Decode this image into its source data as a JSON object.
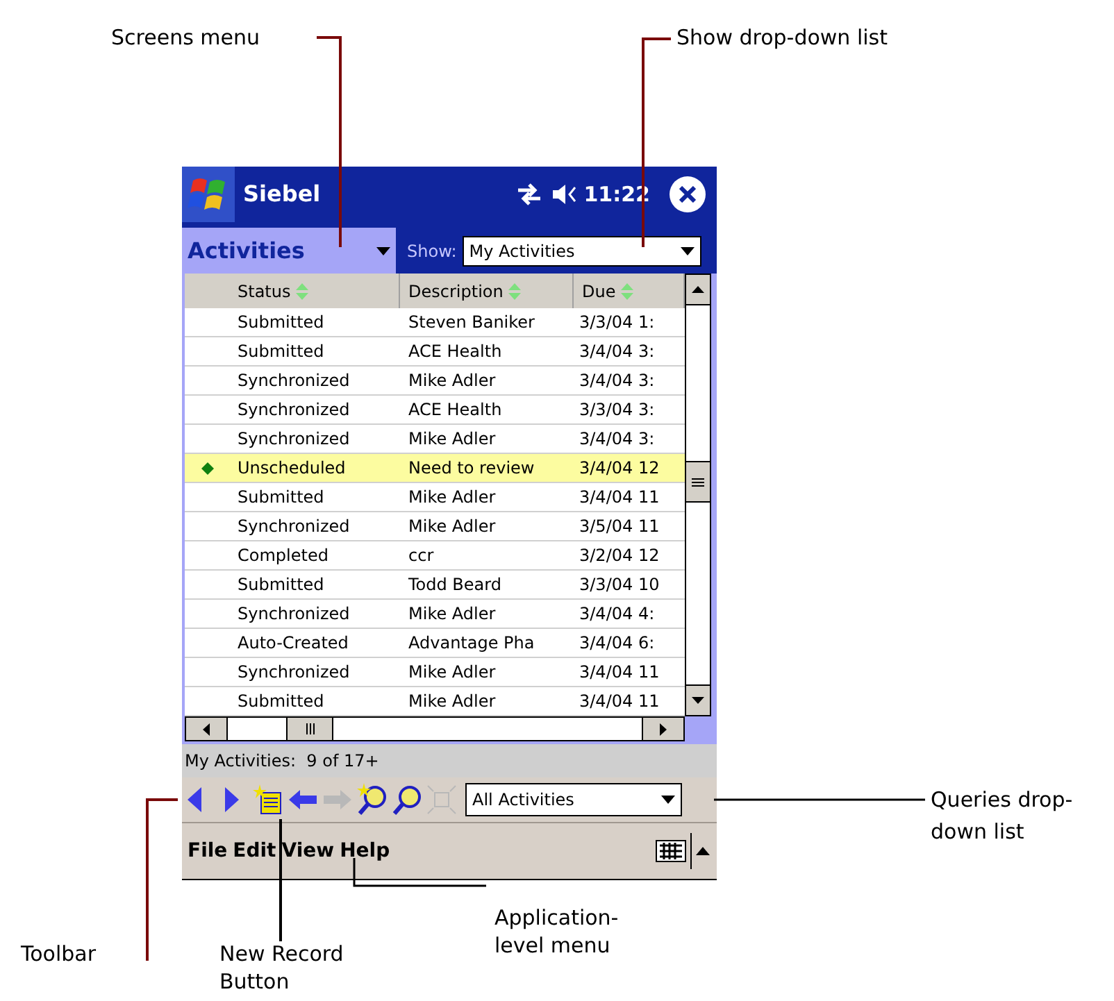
{
  "callouts": {
    "screens_menu": "Screens menu",
    "show_list": "Show drop-down list",
    "queries_list": "Queries drop-down list",
    "toolbar": "Toolbar",
    "new_record": "New Record Button",
    "app_menu": "Application-level menu"
  },
  "title_bar": {
    "title": "Siebel",
    "time": "11:22"
  },
  "screens_tab": {
    "label": "Activities"
  },
  "show": {
    "label": "Show:",
    "value": "My Activities"
  },
  "table": {
    "columns": [
      "Status",
      "Description",
      "Due"
    ],
    "rows": [
      {
        "status": "Submitted",
        "description": "Steven Baniker",
        "due": "3/3/04 1:",
        "selected": false
      },
      {
        "status": "Submitted",
        "description": "ACE Health",
        "due": "3/4/04 3:",
        "selected": false
      },
      {
        "status": "Synchronized",
        "description": "Mike Adler",
        "due": "3/4/04 3:",
        "selected": false
      },
      {
        "status": "Synchronized",
        "description": "ACE Health",
        "due": "3/3/04 3:",
        "selected": false
      },
      {
        "status": "Synchronized",
        "description": "Mike Adler",
        "due": "3/4/04 3:",
        "selected": false
      },
      {
        "status": "Unscheduled",
        "description": "Need to review",
        "due": "3/4/04 12",
        "selected": true
      },
      {
        "status": "Submitted",
        "description": "Mike Adler",
        "due": "3/4/04 11",
        "selected": false
      },
      {
        "status": "Synchronized",
        "description": "Mike Adler",
        "due": "3/5/04 11",
        "selected": false
      },
      {
        "status": "Completed",
        "description": "ccr",
        "due": "3/2/04 12",
        "selected": false
      },
      {
        "status": "Submitted",
        "description": "Todd Beard",
        "due": "3/3/04 10",
        "selected": false
      },
      {
        "status": "Synchronized",
        "description": "Mike Adler",
        "due": "3/4/04 4:",
        "selected": false
      },
      {
        "status": "Auto-Created",
        "description": "Advantage Pha",
        "due": "3/4/04 6:",
        "selected": false
      },
      {
        "status": "Synchronized",
        "description": "Mike Adler",
        "due": "3/4/04 11",
        "selected": false
      },
      {
        "status": "Submitted",
        "description": "Mike Adler",
        "due": "3/4/04 11",
        "selected": false
      }
    ]
  },
  "status_line": "My Activities:  9 of 17+",
  "toolbar": [
    {
      "kind": "prev",
      "disabled": false
    },
    {
      "kind": "next",
      "disabled": false
    },
    {
      "kind": "new",
      "disabled": false
    },
    {
      "kind": "back",
      "disabled": false
    },
    {
      "kind": "forward",
      "disabled": true
    },
    {
      "kind": "new_query",
      "disabled": false
    },
    {
      "kind": "query",
      "disabled": false
    },
    {
      "kind": "expand",
      "disabled": true
    }
  ],
  "queries": {
    "value": "All Activities"
  },
  "menu": [
    "File",
    "Edit",
    "View",
    "Help"
  ]
}
